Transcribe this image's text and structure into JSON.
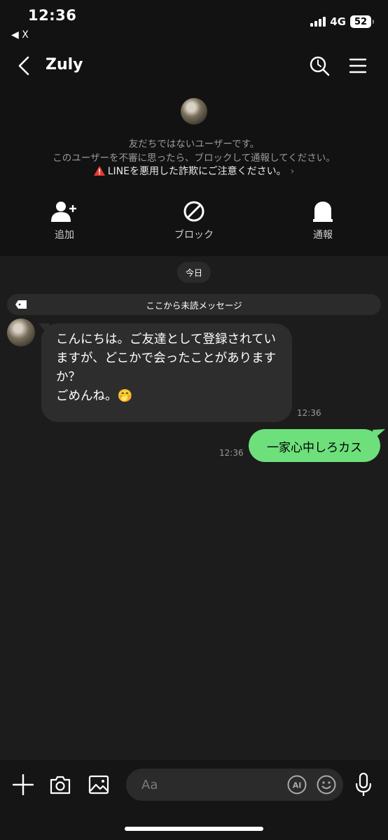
{
  "status": {
    "time": "12:36",
    "back_app": "◀ X",
    "network": "4G",
    "battery": "52"
  },
  "header": {
    "title": "Zuly"
  },
  "notice": {
    "line1": "友だちではないユーザーです。",
    "line2": "このユーザーを不審に思ったら、ブロックして通報してください。",
    "warning": "LINEを悪用した詐欺にご注意ください。"
  },
  "actions": [
    {
      "label": "追加",
      "icon": "add-friend-icon"
    },
    {
      "label": "ブロック",
      "icon": "block-icon"
    },
    {
      "label": "通報",
      "icon": "report-icon"
    }
  ],
  "chat": {
    "date": "今日",
    "unread": "ここから未読メッセージ",
    "messages": [
      {
        "from": "other",
        "text": "こんにちは。ご友達として登録されていますが、どこかで会ったことがありますか？\nごめんね。🤭",
        "time": "12:36"
      },
      {
        "from": "me",
        "text": "一家心中しろカス",
        "time": "12:36"
      }
    ]
  },
  "composer": {
    "placeholder": "Aa"
  },
  "colors": {
    "sent_bubble": "#6de07c",
    "received_bubble": "#2d2d2d",
    "background": "#1c1c1c"
  }
}
